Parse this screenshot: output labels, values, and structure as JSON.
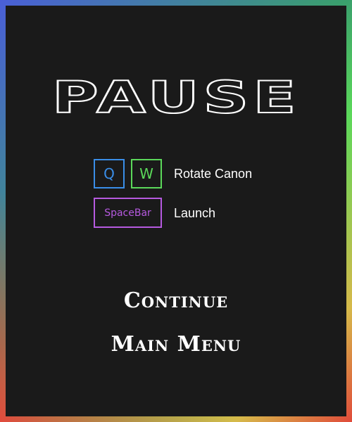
{
  "pause": {
    "title": "PAUSE"
  },
  "controls": {
    "rotate": {
      "keys": [
        "Q",
        "W"
      ],
      "label": "Rotate Canon"
    },
    "launch": {
      "key": "SpaceBar",
      "label": "Launch"
    }
  },
  "menu": {
    "continue_label": "Continue",
    "main_menu_label": "Main Menu"
  },
  "colors": {
    "background": "#1a1a1a",
    "key_q": "#3a8ee8",
    "key_w": "#5bd85a",
    "key_space": "#b65ae0",
    "text": "#ffffff"
  }
}
